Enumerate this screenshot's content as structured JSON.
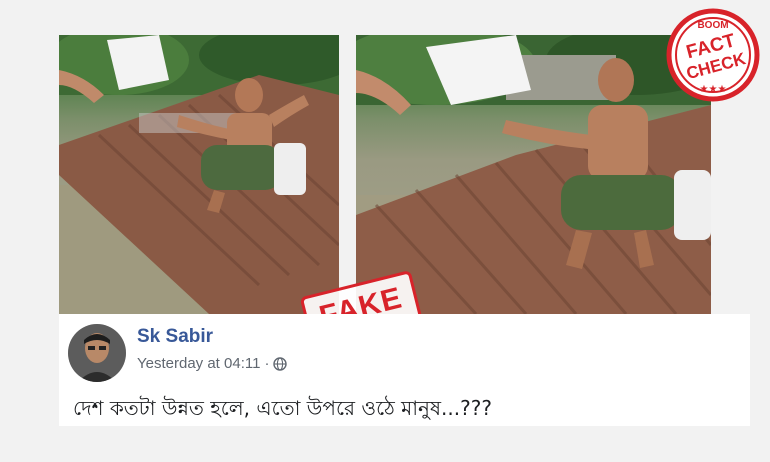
{
  "stamp": {
    "text": "FAKE"
  },
  "badge": {
    "top": "BOOM",
    "line1": "FACT",
    "line2": "CHECK",
    "stars": "★★★"
  },
  "post": {
    "author": "Sk Sabir",
    "timestamp": "Yesterday at 04:11",
    "separator": "·",
    "privacy_icon": "globe-icon",
    "text": "দেশ কতটা উন্নত হলে, এতো উপরে ওঠে মানুষ...???"
  },
  "colors": {
    "stamp_red": "#d8232a",
    "author_blue": "#385898",
    "meta_gray": "#606770"
  }
}
